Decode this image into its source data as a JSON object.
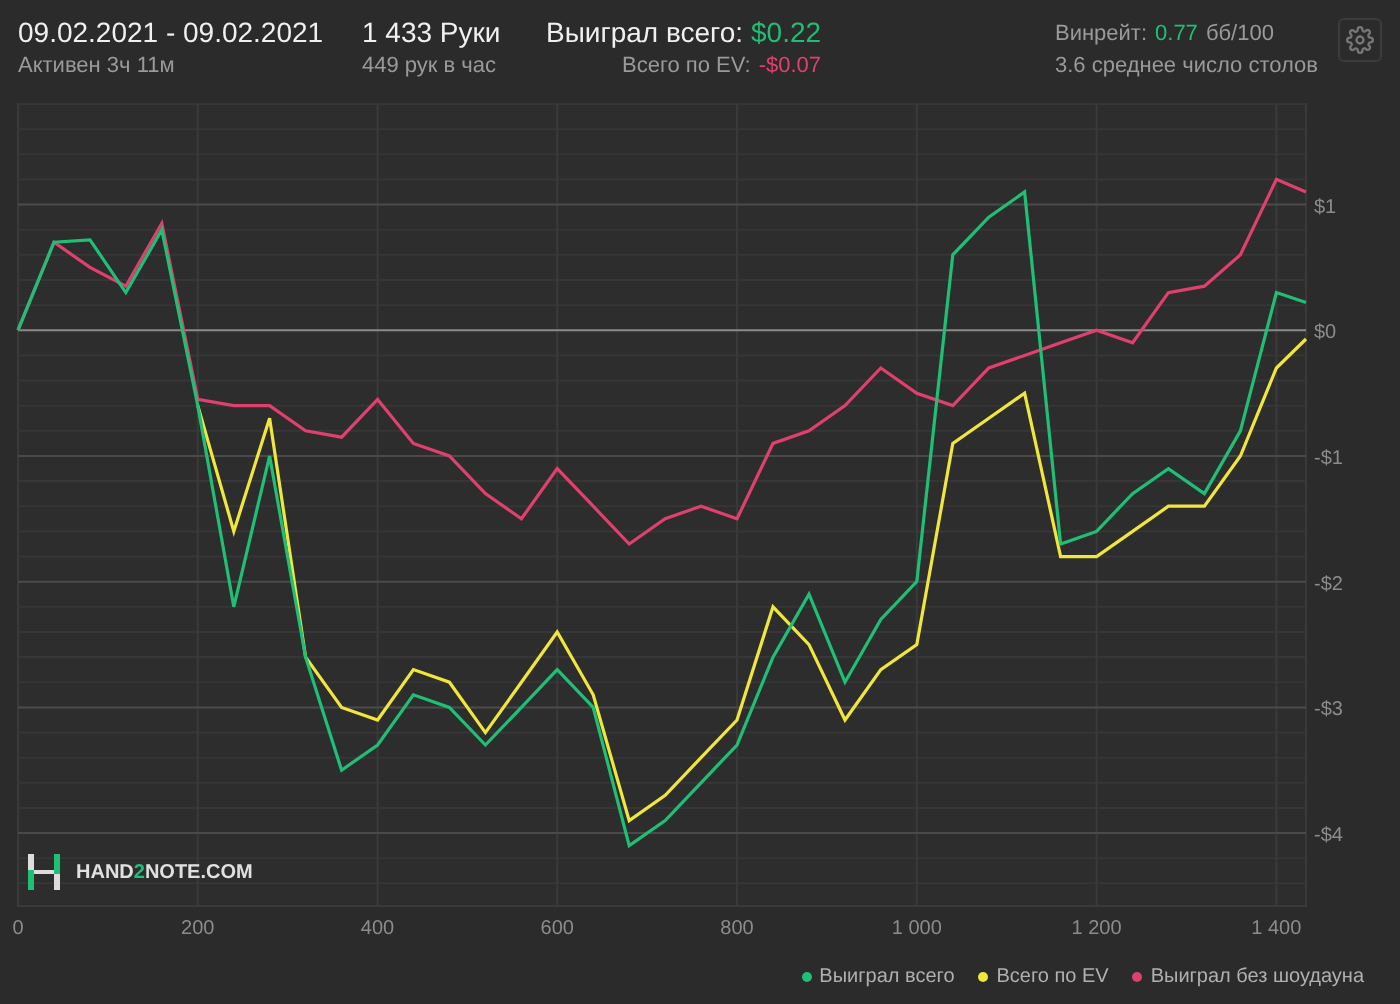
{
  "header": {
    "date_range": "09.02.2021 - 09.02.2021",
    "active_time": "Активен 3ч 11м",
    "hands": "1 433 Руки",
    "hands_per_hour": "449 рук в час",
    "won_total": {
      "label": "Выиграл всего:",
      "value": "$0.22"
    },
    "ev_total": {
      "label": "Всего по EV:",
      "value": "-$0.07"
    },
    "winrate": {
      "label": "Винрейт:",
      "value": "0.77",
      "unit": "бб/100"
    },
    "tables": "3.6 среднее число столов"
  },
  "chart": {
    "logo": {
      "before": "HAND",
      "accent": "2",
      "after": "NOTE.COM"
    },
    "chart_data": {
      "type": "line",
      "grid": true,
      "x": [
        0,
        40,
        80,
        120,
        160,
        200,
        240,
        280,
        320,
        360,
        400,
        440,
        480,
        520,
        560,
        600,
        640,
        680,
        720,
        760,
        800,
        840,
        880,
        920,
        960,
        1000,
        1040,
        1080,
        1120,
        1160,
        1200,
        1240,
        1280,
        1320,
        1360,
        1400,
        1433
      ],
      "xlim": [
        0,
        1433
      ],
      "ylim": [
        -4.58,
        1.8
      ],
      "xticks": [
        {
          "value": 0,
          "label": "0"
        },
        {
          "value": 200,
          "label": "200"
        },
        {
          "value": 400,
          "label": "400"
        },
        {
          "value": 600,
          "label": "600"
        },
        {
          "value": 800,
          "label": "800"
        },
        {
          "value": 1000,
          "label": "1 000"
        },
        {
          "value": 1200,
          "label": "1 200"
        },
        {
          "value": 1400,
          "label": "1 400"
        }
      ],
      "yticks": [
        {
          "value": 1,
          "label": "$1"
        },
        {
          "value": 0,
          "label": "$0"
        },
        {
          "value": -1,
          "label": "-$1"
        },
        {
          "value": -2,
          "label": "-$2"
        },
        {
          "value": -3,
          "label": "-$3"
        },
        {
          "value": -4,
          "label": "-$4"
        }
      ],
      "series": [
        {
          "name": "Выиграл всего",
          "color": "#1fbf75",
          "values": [
            0,
            0.7,
            0.72,
            0.3,
            0.8,
            -0.6,
            -2.2,
            -1.0,
            -2.6,
            -3.5,
            -3.3,
            -2.9,
            -3.0,
            -3.3,
            -3.0,
            -2.7,
            -3.0,
            -4.1,
            -3.9,
            -3.6,
            -3.3,
            -2.6,
            -2.1,
            -2.8,
            -2.3,
            -2.0,
            0.6,
            0.9,
            1.1,
            -1.7,
            -1.6,
            -1.3,
            -1.1,
            -1.3,
            -0.8,
            0.3,
            0.22
          ]
        },
        {
          "name": "Всего по EV",
          "color": "#f0e63c",
          "values": [
            null,
            null,
            null,
            null,
            null,
            -0.6,
            -1.6,
            -0.7,
            -2.6,
            -3.0,
            -3.1,
            -2.7,
            -2.8,
            -3.2,
            -2.8,
            -2.4,
            -2.9,
            -3.9,
            -3.7,
            -3.4,
            -3.1,
            -2.2,
            -2.5,
            -3.1,
            -2.7,
            -2.5,
            -0.9,
            -0.7,
            -0.5,
            -1.8,
            -1.8,
            -1.6,
            -1.4,
            -1.4,
            -1.0,
            -0.3,
            -0.07
          ]
        },
        {
          "name": "Выиграл без шоудауна",
          "color": "#e0406e",
          "values": [
            0,
            0.7,
            0.5,
            0.35,
            0.85,
            -0.55,
            -0.6,
            -0.6,
            -0.8,
            -0.85,
            -0.55,
            -0.9,
            -1.0,
            -1.3,
            -1.5,
            -1.1,
            -1.4,
            -1.7,
            -1.5,
            -1.4,
            -1.5,
            -0.9,
            -0.8,
            -0.6,
            -0.3,
            -0.5,
            -0.6,
            -0.3,
            -0.2,
            -0.1,
            0.0,
            -0.1,
            0.3,
            0.35,
            0.6,
            1.2,
            1.1
          ]
        }
      ]
    }
  }
}
